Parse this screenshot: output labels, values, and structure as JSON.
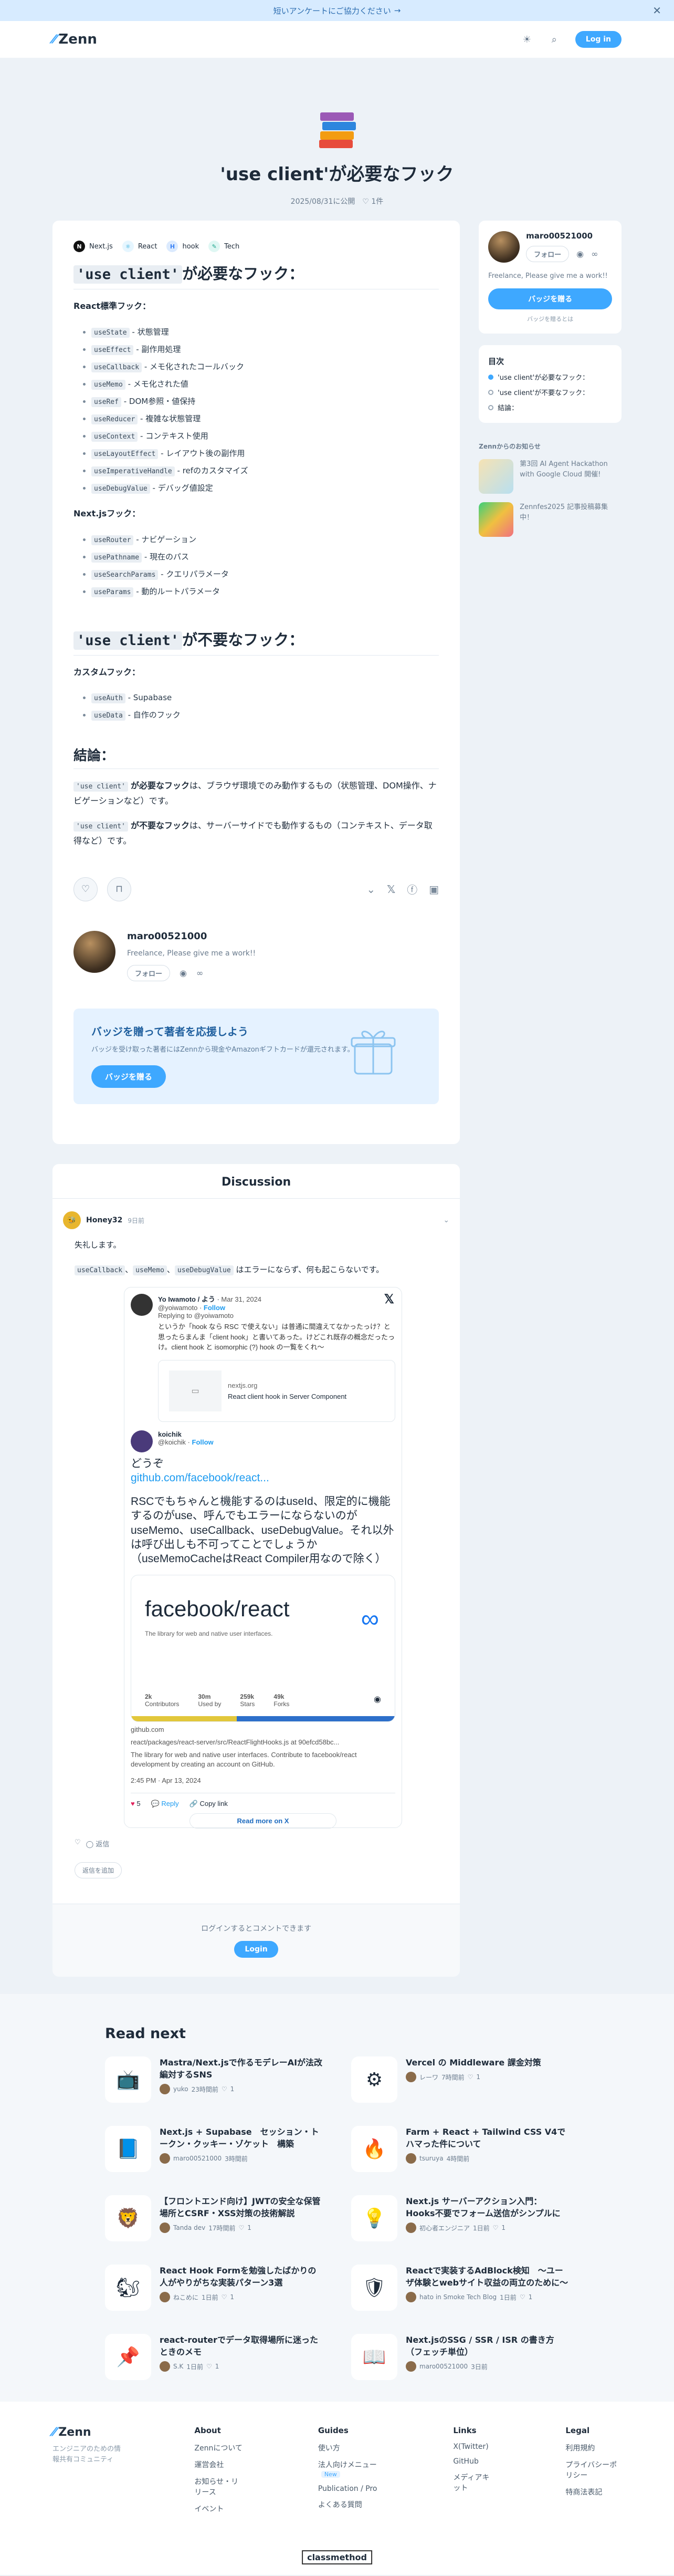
{
  "banner": {
    "text": "短いアンケートにご協力ください",
    "arrow": "→"
  },
  "header": {
    "logo": "Zenn",
    "login": "Log in"
  },
  "hero": {
    "title": "'use client'が必要なフック",
    "date": "2025/08/31に公開",
    "likes": "1件"
  },
  "tags": [
    {
      "label": "Next.js",
      "icon": "N",
      "bg": "#111",
      "fg": "#fff"
    },
    {
      "label": "React",
      "icon": "⚛",
      "bg": "#e6f6ff",
      "fg": "#21a6d8"
    },
    {
      "label": "hook",
      "icon": "H",
      "bg": "#dbeafe",
      "fg": "#3b82f6"
    },
    {
      "label": "Tech",
      "icon": "✎",
      "bg": "#dff7f3",
      "fg": "#1aa38a"
    }
  ],
  "article": {
    "h2a_code": "'use client'",
    "h2a_text": "が必要なフック：",
    "p_react": "React標準フック：",
    "react_hooks": [
      {
        "code": "useState",
        "desc": " - 状態管理"
      },
      {
        "code": "useEffect",
        "desc": " - 副作用処理"
      },
      {
        "code": "useCallback",
        "desc": " - メモ化されたコールバック"
      },
      {
        "code": "useMemo",
        "desc": " - メモ化された値"
      },
      {
        "code": "useRef",
        "desc": " - DOM参照・値保持"
      },
      {
        "code": "useReducer",
        "desc": " - 複雑な状態管理"
      },
      {
        "code": "useContext",
        "desc": " - コンテキスト使用"
      },
      {
        "code": "useLayoutEffect",
        "desc": " - レイアウト後の副作用"
      },
      {
        "code": "useImperativeHandle",
        "desc": " - refのカスタマイズ"
      },
      {
        "code": "useDebugValue",
        "desc": " - デバッグ値設定"
      }
    ],
    "p_next": "Next.jsフック：",
    "next_hooks": [
      {
        "code": "useRouter",
        "desc": " - ナビゲーション"
      },
      {
        "code": "usePathname",
        "desc": " - 現在のパス"
      },
      {
        "code": "useSearchParams",
        "desc": " - クエリパラメータ"
      },
      {
        "code": "useParams",
        "desc": " - 動的ルートパラメータ"
      }
    ],
    "h2b_code": "'use client'",
    "h2b_text": "が不要なフック：",
    "p_custom": "カスタムフック：",
    "custom_hooks": [
      {
        "code": "useAuth",
        "desc": " - Supabase"
      },
      {
        "code": "useData",
        "desc": " - 自作のフック"
      }
    ],
    "h3_conclusion": "結論：",
    "c1_code": "'use client'",
    "c1_bold": "が必要なフック",
    "c1_text": "は、ブラウザ環境でのみ動作するもの（状態管理、DOM操作、ナビゲーションなど）です。",
    "c2_code": "'use client'",
    "c2_bold": "が不要なフック",
    "c2_text": "は、サーバーサイドでも動作するもの（コンテキスト、データ取得など）です。"
  },
  "author": {
    "name": "maro00521000",
    "bio": "Freelance, Please give me a work!!",
    "follow": "フォロー"
  },
  "support": {
    "title": "バッジを贈って著者を応援しよう",
    "desc": "バッジを受け取った著者にはZennから現金やAmazonギフトカードが還元されます。",
    "button": "バッジを贈る"
  },
  "discussion": {
    "title": "Discussion",
    "user": "Honey32",
    "time": "9日前",
    "text1": "失礼します。",
    "text2_codes": [
      "useCallback",
      "useMemo",
      "useDebugValue"
    ],
    "sep": "、",
    "text2_rest": " はエラーにならず、何も起こらないです。",
    "tweet": {
      "author1": "Yo Iwamoto / よう",
      "date1": "Mar 31, 2024",
      "handle1": "@yoiwamoto",
      "follow": "Follow",
      "replying": "Replying to @yoiwamoto",
      "quote": "というか「hook なら RSC で使えない」は普通に間違えてなかったっけ？と思ったらまんま「client hook」と書いてあった。けどこれ既存の概念だったっけ。client hook と isomorphic (?) hook の一覧をくれ～",
      "card_domain": "nextjs.org",
      "card_title": "React client hook in Server Component",
      "author2": "koichik",
      "handle2": "@koichik",
      "dot": "·",
      "t1": "どうぞ",
      "link": "github.com/facebook/react...",
      "t2": "RSCでもちゃんと機能するのはuseId、限定的に機能するのがuse、呼んでもエラーにならないのがuseMemo、useCallback、useDebugValue。それ以外は呼び出しも不可ってことでしょうか",
      "t3": "（useMemoCacheはReact Compiler用なので除く）",
      "gh_title": "facebook/react",
      "gh_desc": "The library for web and native user interfaces.",
      "gh_stats": [
        {
          "v": "2k",
          "l": "Contributors"
        },
        {
          "v": "30m",
          "l": "Used by"
        },
        {
          "v": "259k",
          "l": "Stars"
        },
        {
          "v": "49k",
          "l": "Forks"
        }
      ],
      "gh_domain": "github.com",
      "gh_path": "react/packages/react-server/src/ReactFlightHooks.js at 90efcd58bc...",
      "gh_sub": "The library for web and native user interfaces. Contribute to facebook/react development by creating an account on GitHub.",
      "time": "2:45 PM · Apr 13, 2024",
      "likes": "5",
      "reply": "Reply",
      "copy": "Copy link",
      "readmore": "Read more on X"
    },
    "like_label": "返信",
    "reply_btn": "返信を追加",
    "login_prompt": "ログインするとコメントできます",
    "login": "Login"
  },
  "sidebar": {
    "name": "maro00521000",
    "follow": "フォロー",
    "bio": "Freelance, Please give me a work!!",
    "badge": "バッジを贈る",
    "badge_note": "バッジを贈るとは",
    "toc_title": "目次",
    "toc": [
      "'use client'が必要なフック：",
      "'use client'が不要なフック：",
      "結論："
    ],
    "notice_title": "Zennからのお知らせ",
    "notices": [
      "第3回 AI Agent Hackathon with Google Cloud 開催!",
      "Zennfes2025 記事投稿募集中！"
    ]
  },
  "readnext": {
    "title": "Read next",
    "items": [
      {
        "icon": "📺",
        "title": "Mastra/Next.jsで作るモデレーAIが法改編対するSNS",
        "author": "yuko",
        "meta": "23時間前",
        "likes": "1"
      },
      {
        "icon": "⚙",
        "title": "Vercel の Middleware 課金対策",
        "author": "レーワ",
        "meta": "7時間前",
        "likes": "1"
      },
      {
        "icon": "📘",
        "title": "Next.js + Supabase　セッション・トークン・クッキー・ゾケット　構築",
        "author": "maro00521000",
        "meta": "3時間前",
        "likes": ""
      },
      {
        "icon": "🔥",
        "title": "Farm + React + Tailwind CSS V4でハマった件について",
        "author": "tsuruya",
        "meta": "4時間前",
        "likes": ""
      },
      {
        "icon": "🦁",
        "title": "【フロントエンド向け】JWTの安全な保管場所とCSRF・XSS対策の技術解説",
        "author": "Tanda dev",
        "meta": "17時間前",
        "likes": "1"
      },
      {
        "icon": "💡",
        "title": "Next.js サーバーアクション入門：Hooks不要でフォーム送信がシンプルに",
        "author": "初心者エンジニア",
        "meta": "1日前",
        "likes": "1"
      },
      {
        "icon": "🐿",
        "title": "React Hook Formを勉強したばかりの人がやりがちな実装パターン3選",
        "author": "ねこめに",
        "meta": "1日前",
        "likes": "1"
      },
      {
        "icon": "🛡",
        "title": "Reactで実装するAdBlock検知　～ユーザ体験とwebサイト収益の両立のために～",
        "author": "hato in Smoke Tech Blog",
        "meta": "1日前",
        "likes": "1"
      },
      {
        "icon": "📌",
        "title": "react-routerでデータ取得場所に迷ったときのメモ",
        "author": "S.K",
        "meta": "1日前",
        "likes": "1"
      },
      {
        "icon": "📖",
        "title": "Next.jsのSSG / SSR / ISR の書き方（フェッチ単位）",
        "author": "maro00521000",
        "meta": "3日前",
        "likes": ""
      }
    ]
  },
  "footer": {
    "logo": "Zenn",
    "tagline": "エンジニアのための情報共有コミュニティ",
    "cols": [
      {
        "title": "About",
        "links": [
          "Zennについて",
          "運営会社",
          "お知らせ・リリース",
          "イベント"
        ]
      },
      {
        "title": "Guides",
        "links": [
          "使い方",
          "法人向けメニュー",
          "Publication / Pro",
          "よくある質問"
        ],
        "new": "New"
      },
      {
        "title": "Links",
        "links": [
          "X(Twitter)",
          "GitHub",
          "メディアキット"
        ]
      },
      {
        "title": "Legal",
        "links": [
          "利用規約",
          "プライバシーポリシー",
          "特商法表記"
        ]
      }
    ],
    "cm": "classmethod"
  },
  "colors": {
    "accent": "#3ea8ff",
    "bg": "#edf2f7"
  }
}
